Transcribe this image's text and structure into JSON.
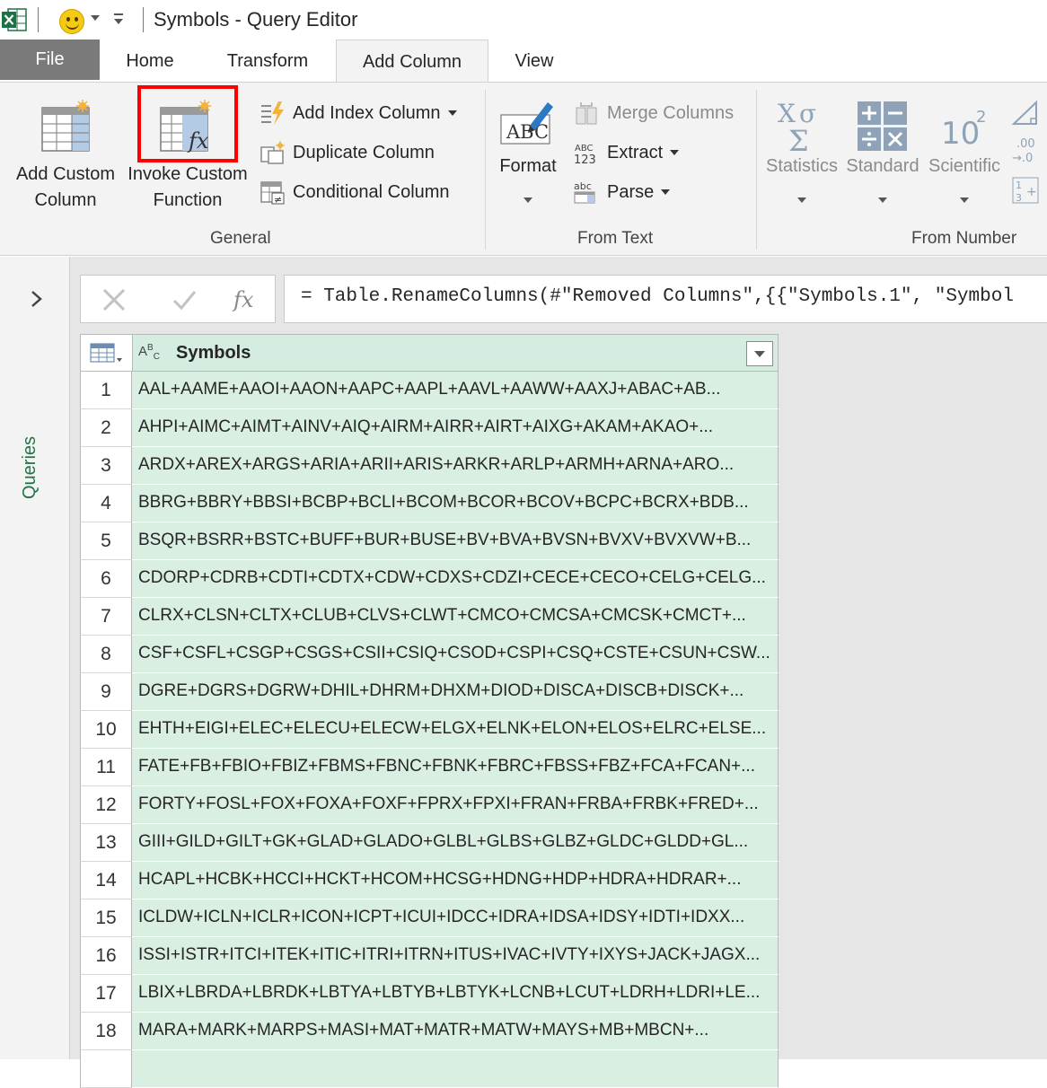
{
  "window": {
    "title": "Symbols - Query Editor"
  },
  "tabs": [
    {
      "label": "File"
    },
    {
      "label": "Home"
    },
    {
      "label": "Transform"
    },
    {
      "label": "Add Column"
    },
    {
      "label": "View"
    }
  ],
  "ribbon": {
    "general": {
      "label": "General",
      "add_custom_column": [
        "Add Custom",
        "Column"
      ],
      "invoke_custom_function": [
        "Invoke Custom",
        "Function"
      ],
      "add_index_column": "Add Index Column",
      "duplicate_column": "Duplicate Column",
      "conditional_column": "Conditional Column"
    },
    "from_text": {
      "label": "From Text",
      "format": "Format",
      "merge_columns": "Merge Columns",
      "extract": "Extract",
      "parse": "Parse"
    },
    "from_number": {
      "label": "From Number",
      "statistics": "Statistics",
      "standard": "Standard",
      "scientific": "Scientific"
    }
  },
  "queries_pane": {
    "label": "Queries"
  },
  "formula_bar": {
    "formula": "= Table.RenameColumns(#\"Removed Columns\",{{\"Symbols.1\", \"Symbol"
  },
  "table": {
    "column_type": "ABC",
    "column_name": "Symbols",
    "rows": [
      {
        "n": "1",
        "value": "AAL+AAME+AAOI+AAON+AAPC+AAPL+AAVL+AAWW+AAXJ+ABAC+AB..."
      },
      {
        "n": "2",
        "value": "AHPI+AIMC+AIMT+AINV+AIQ+AIRM+AIRR+AIRT+AIXG+AKAM+AKAO+..."
      },
      {
        "n": "3",
        "value": "ARDX+AREX+ARGS+ARIA+ARII+ARIS+ARKR+ARLP+ARMH+ARNA+ARO..."
      },
      {
        "n": "4",
        "value": "BBRG+BBRY+BBSI+BCBP+BCLI+BCOM+BCOR+BCOV+BCPC+BCRX+BDB..."
      },
      {
        "n": "5",
        "value": "BSQR+BSRR+BSTC+BUFF+BUR+BUSE+BV+BVA+BVSN+BVXV+BVXVW+B..."
      },
      {
        "n": "6",
        "value": "CDORP+CDRB+CDTI+CDTX+CDW+CDXS+CDZI+CECE+CECO+CELG+CELG..."
      },
      {
        "n": "7",
        "value": "CLRX+CLSN+CLTX+CLUB+CLVS+CLWT+CMCO+CMCSA+CMCSK+CMCT+..."
      },
      {
        "n": "8",
        "value": "CSF+CSFL+CSGP+CSGS+CSII+CSIQ+CSOD+CSPI+CSQ+CSTE+CSUN+CSW..."
      },
      {
        "n": "9",
        "value": "DGRE+DGRS+DGRW+DHIL+DHRM+DHXM+DIOD+DISCA+DISCB+DISCK+..."
      },
      {
        "n": "10",
        "value": "EHTH+EIGI+ELEC+ELECU+ELECW+ELGX+ELNK+ELON+ELOS+ELRC+ELSE..."
      },
      {
        "n": "11",
        "value": "FATE+FB+FBIO+FBIZ+FBMS+FBNC+FBNK+FBRC+FBSS+FBZ+FCA+FCAN+..."
      },
      {
        "n": "12",
        "value": "FORTY+FOSL+FOX+FOXA+FOXF+FPRX+FPXI+FRAN+FRBA+FRBK+FRED+..."
      },
      {
        "n": "13",
        "value": "GIII+GILD+GILT+GK+GLAD+GLADO+GLBL+GLBS+GLBZ+GLDC+GLDD+GL..."
      },
      {
        "n": "14",
        "value": "HCAPL+HCBK+HCCI+HCKT+HCOM+HCSG+HDNG+HDP+HDRA+HDRAR+..."
      },
      {
        "n": "15",
        "value": "ICLDW+ICLN+ICLR+ICON+ICPT+ICUI+IDCC+IDRA+IDSA+IDSY+IDTI+IDXX..."
      },
      {
        "n": "16",
        "value": "ISSI+ISTR+ITCI+ITEK+ITIC+ITRI+ITRN+ITUS+IVAC+IVTY+IXYS+JACK+JAGX..."
      },
      {
        "n": "17",
        "value": "LBIX+LBRDA+LBRDK+LBTYA+LBTYB+LBTYK+LCNB+LCUT+LDRH+LDRI+LE..."
      },
      {
        "n": "18",
        "value": "MARA+MARK+MARPS+MASI+MAT+MATR+MATW+MAYS+MB+MBCN+..."
      },
      {
        "n": "",
        "value": ""
      }
    ]
  },
  "colors": {
    "excel_green": "#217346",
    "selected_column": "#d9efe2",
    "highlight_box": "#ff0000",
    "file_tab": "#7a7a7a"
  }
}
